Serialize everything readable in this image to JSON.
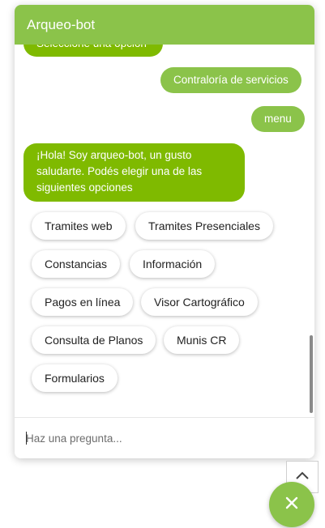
{
  "header": {
    "title": "Arqueo-bot"
  },
  "messages": {
    "partial_bot": "Seleccione una opción",
    "user_1": "Contraloría de servicios",
    "user_2": "menu",
    "bot_greeting": "¡Hola! Soy arqueo-bot, un gusto saludarte. Podés elegir una de las siguientes opciones"
  },
  "options": [
    "Tramites web",
    "Tramites Presenciales",
    "Constancias",
    "Información",
    "Pagos en línea",
    "Visor Cartográfico",
    "Consulta de Planos",
    "Munis CR",
    "Formularios"
  ],
  "input": {
    "placeholder": "Haz una pregunta..."
  },
  "icons": {
    "scroll_top": "chevron-up-icon",
    "close": "close-icon"
  },
  "colors": {
    "accent": "#8bc34a",
    "bot_bubble": "#7fba00"
  }
}
